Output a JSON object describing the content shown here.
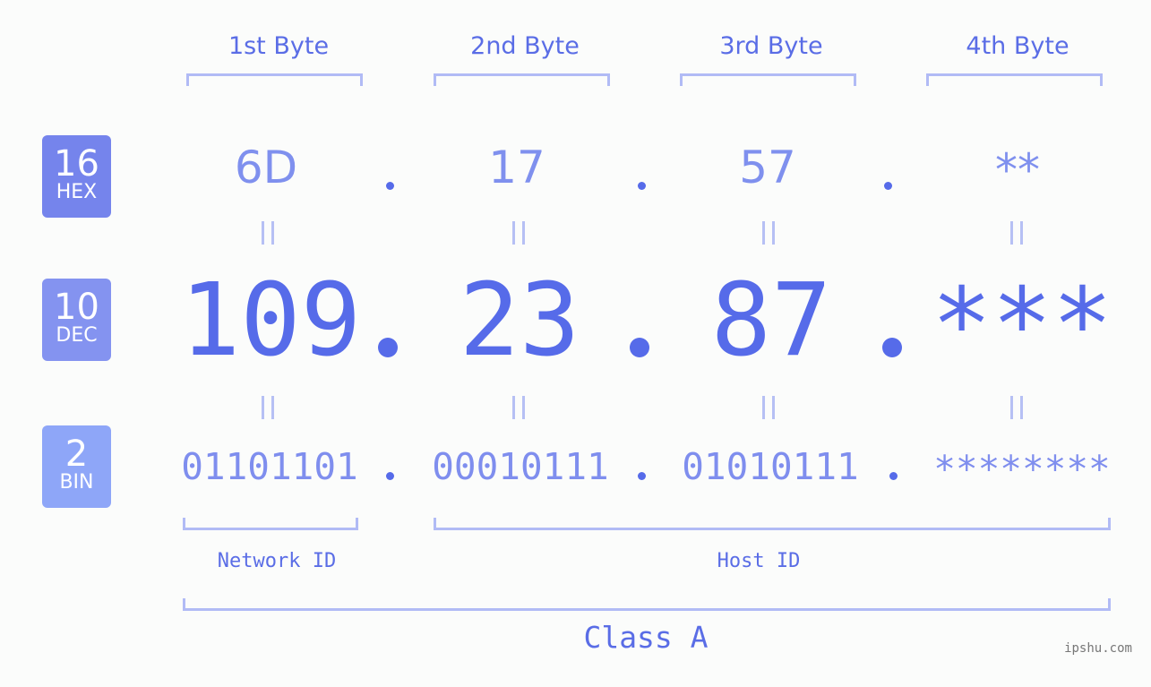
{
  "bytes": {
    "headers": [
      "1st Byte",
      "2nd Byte",
      "3rd Byte",
      "4th Byte"
    ],
    "hex": [
      "6D",
      "17",
      "57",
      "**"
    ],
    "dec": [
      "109",
      "23",
      "87",
      "***"
    ],
    "bin": [
      "01101101",
      "00010111",
      "01010111",
      "********"
    ]
  },
  "badges": {
    "hex": {
      "base": "16",
      "label": "HEX",
      "color": "#7584ec"
    },
    "dec": {
      "base": "10",
      "label": "DEC",
      "color": "#8493f0"
    },
    "bin": {
      "base": "2",
      "label": "BIN",
      "color": "#8ea6f8"
    }
  },
  "separator": ".",
  "segments": {
    "network": "Network ID",
    "host": "Host ID",
    "class": "Class A"
  },
  "colors": {
    "accent": "#566be9",
    "bracket": "#b1bbf5",
    "hex_text": "#7f90ee",
    "bin_text": "#7f8eee"
  },
  "watermark": "ipshu.com"
}
